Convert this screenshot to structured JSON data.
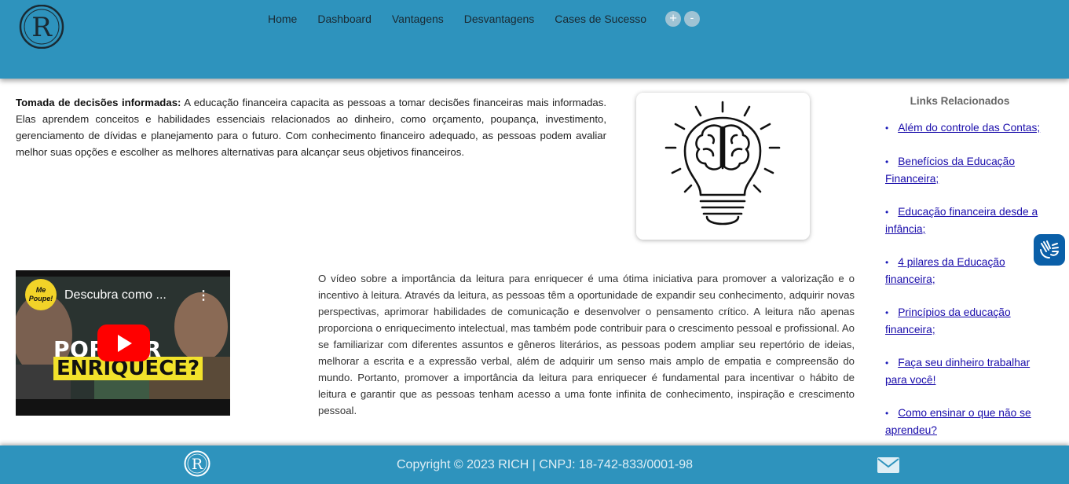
{
  "header": {
    "logo_letter": "R",
    "nav": [
      "Home",
      "Dashboard",
      "Vantagens",
      "Desvantagens",
      "Cases de Sucesso"
    ],
    "zoom_in": "+",
    "zoom_out": "-"
  },
  "intro": {
    "bold": "Tomada de decisões informadas:",
    "text": " A educação financeira capacita as pessoas a tomar decisões financeiras mais informadas. Elas aprendem conceitos e habilidades essenciais relacionados ao dinheiro, como orçamento, poupança, investimento, gerenciamento de dívidas e planejamento para o futuro. Com conhecimento financeiro adequado, as pessoas podem avaliar melhor suas opções e escolher as melhores alternativas para alcançar seus objetivos financeiros."
  },
  "related": {
    "title": "Links Relacionados",
    "links": [
      "Além do controle das Contas;",
      "Benefícios da Educação Financeira;",
      "Educação financeira desde a infância;",
      "4 pilares da Educação financeira;",
      "Princípios da educação financeira;",
      "Faça seu dinheiro trabalhar para você!",
      "Como ensinar o que não se aprendeu?"
    ]
  },
  "video": {
    "channel": "Me Poupe!",
    "title": "Descubra como ...",
    "menu": "⋮",
    "line1": "POR     LER",
    "line2": "ENRIQUECE?"
  },
  "body_text": "O vídeo sobre a importância da leitura para enriquecer é uma ótima iniciativa para promover a valorização e o incentivo à leitura. Através da leitura, as pessoas têm a oportunidade de expandir seu conhecimento, adquirir novas perspectivas, aprimorar habilidades de comunicação e desenvolver o pensamento crítico. A leitura não apenas proporciona o enriquecimento intelectual, mas também pode contribuir para o crescimento pessoal e profissional. Ao se familiarizar com diferentes assuntos e gêneros literários, as pessoas podem ampliar seu repertório de ideias, melhorar a escrita e a expressão verbal, além de adquirir um senso mais amplo de empatia e compreensão do mundo. Portanto, promover a importância da leitura para enriquecer é fundamental para incentivar o hábito de leitura e garantir que as pessoas tenham acesso a uma fonte infinita de conhecimento, inspiração e crescimento pessoal.",
  "footer": {
    "copyright": "Copyright © 2023 RICH | CNPJ: 18-742-833/0001-98"
  },
  "colors": {
    "header_bg": "#2e93bd",
    "link": "#1a0dab",
    "accessibility_bg": "#0a5fa8"
  },
  "icons": [
    "logo-icon",
    "lightbulb-brain-icon",
    "accessibility-hands-icon",
    "play-icon",
    "mail-icon"
  ]
}
